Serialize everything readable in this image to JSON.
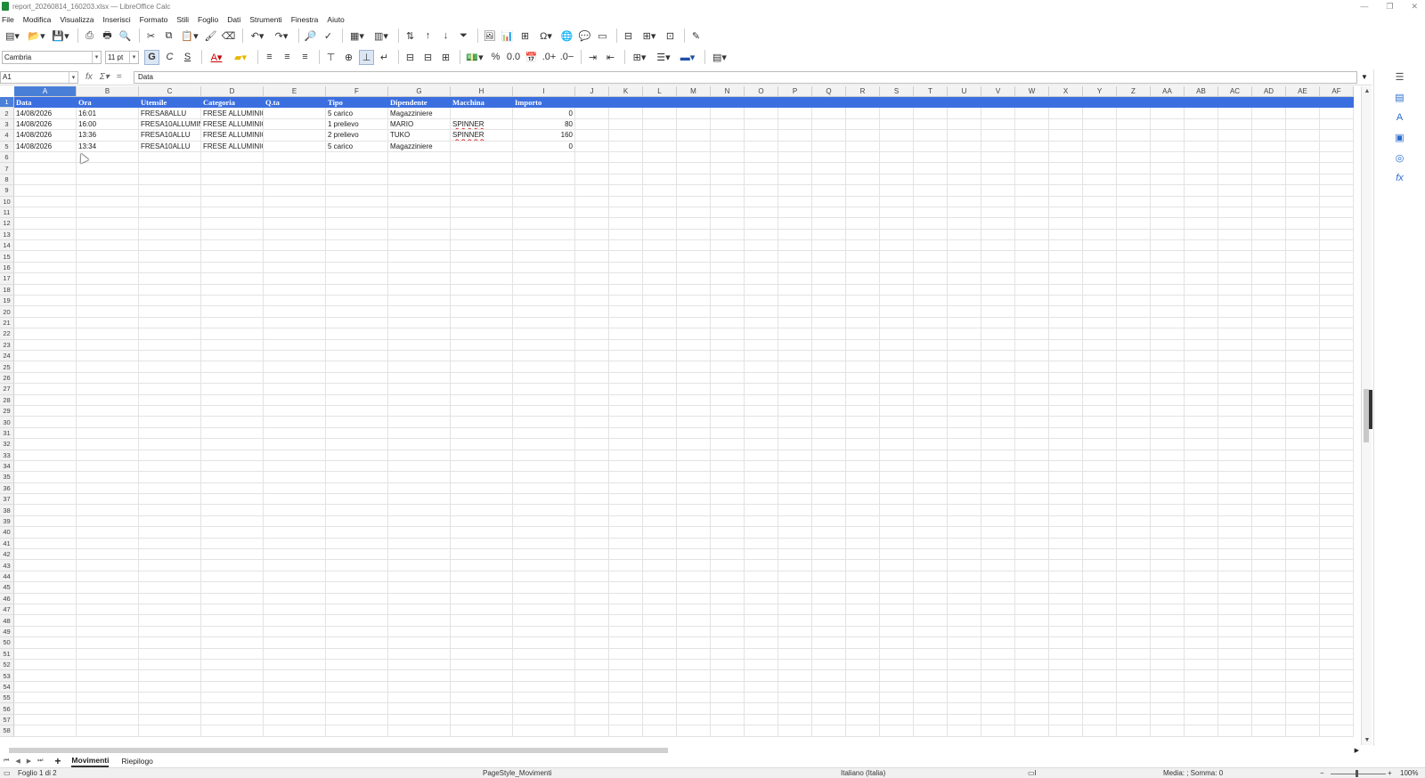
{
  "window": {
    "title": "report_20260814_160203.xlsx — LibreOffice Calc",
    "minimize": "—",
    "restore": "❐",
    "close": "✕"
  },
  "menu": [
    "File",
    "Modifica",
    "Visualizza",
    "Inserisci",
    "Formato",
    "Stili",
    "Foglio",
    "Dati",
    "Strumenti",
    "Finestra",
    "Aiuto"
  ],
  "toolbar2": {
    "font_name": "Cambria",
    "font_size": "11 pt",
    "bold": "G",
    "italic": "C",
    "underline": "S",
    "percent": "%",
    "number": "0.0"
  },
  "formula_bar": {
    "name_box": "A1",
    "content": "Data"
  },
  "columns": [
    {
      "label": "A",
      "width": 70
    },
    {
      "label": "B",
      "width": 70
    },
    {
      "label": "C",
      "width": 70
    },
    {
      "label": "D",
      "width": 70
    },
    {
      "label": "E",
      "width": 70
    },
    {
      "label": "F",
      "width": 70
    },
    {
      "label": "G",
      "width": 70
    },
    {
      "label": "H",
      "width": 70
    },
    {
      "label": "I",
      "width": 70
    },
    {
      "label": "J",
      "width": 38
    },
    {
      "label": "K",
      "width": 38
    },
    {
      "label": "L",
      "width": 38
    },
    {
      "label": "M",
      "width": 38
    },
    {
      "label": "N",
      "width": 38
    },
    {
      "label": "O",
      "width": 38
    },
    {
      "label": "P",
      "width": 38
    },
    {
      "label": "Q",
      "width": 38
    },
    {
      "label": "R",
      "width": 38
    },
    {
      "label": "S",
      "width": 38
    },
    {
      "label": "T",
      "width": 38
    },
    {
      "label": "U",
      "width": 38
    },
    {
      "label": "V",
      "width": 38
    },
    {
      "label": "W",
      "width": 38
    },
    {
      "label": "X",
      "width": 38
    },
    {
      "label": "Y",
      "width": 38
    },
    {
      "label": "Z",
      "width": 38
    },
    {
      "label": "AA",
      "width": 38
    },
    {
      "label": "AB",
      "width": 38
    },
    {
      "label": "AC",
      "width": 38
    },
    {
      "label": "AD",
      "width": 38
    },
    {
      "label": "AE",
      "width": 38
    },
    {
      "label": "AF",
      "width": 38
    }
  ],
  "header_row": [
    "Data",
    "Ora",
    "Utensile",
    "Categoria",
    "Q.ta",
    "Tipo",
    "Dipendente",
    "Macchina",
    "Importo"
  ],
  "rows": [
    [
      "14/08/2026",
      "16:01",
      "FRESA8ALLU",
      "FRESE ALLUMINIO",
      "",
      "5 carico",
      "Magazziniere",
      "",
      "0"
    ],
    [
      "14/08/2026",
      "16:00",
      "FRESA10ALLUMIN",
      "FRESE ALLUMINIO",
      "",
      "1 prelievo",
      "MARIO",
      "SPINNER",
      "80"
    ],
    [
      "14/08/2026",
      "13:36",
      "FRESA10ALLU",
      "FRESE ALLUMINIO",
      "",
      "2 prelievo",
      "TUKO",
      "SPINNER",
      "160"
    ],
    [
      "14/08/2026",
      "13:34",
      "FRESA10ALLU",
      "FRESE ALLUMINIO",
      "",
      "5 carico",
      "Magazziniere",
      "",
      "0"
    ]
  ],
  "row_count": 58,
  "sheets": [
    {
      "name": "Movimenti",
      "active": true
    },
    {
      "name": "Riepilogo",
      "active": false
    }
  ],
  "status": {
    "sheet_info": "Foglio 1 di 2",
    "page_style": "PageStyle_Movimenti",
    "language": "Italiano (Italia)",
    "summary": "Media: ; Somma: 0",
    "zoom": "100%"
  },
  "colors": {
    "header_fill": "#3b6fe0",
    "selection": "#4a7fd8"
  }
}
